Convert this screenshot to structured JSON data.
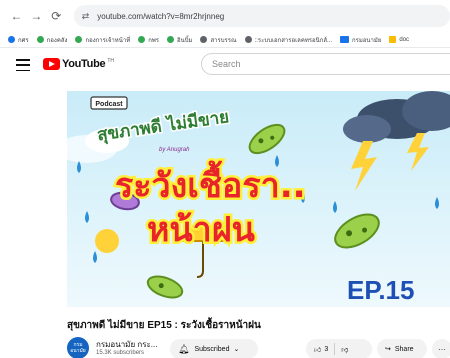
{
  "browser": {
    "url": "youtube.com/watch?v=8mr2hrjnneg",
    "bookmarks": [
      {
        "label": "กศร",
        "icon": "globe-icon"
      },
      {
        "label": "กองคลัง",
        "icon": "globe-icon"
      },
      {
        "label": "กองการเจ้าหน้าที่",
        "icon": "globe-icon"
      },
      {
        "label": "กพร",
        "icon": "globe-icon"
      },
      {
        "label": "อินบิ้ม",
        "icon": "globe-icon"
      },
      {
        "label": "สารบรรณ",
        "icon": "globe-icon"
      },
      {
        "label": "::ระบบเอกสารอเลคทรอนิกส์...",
        "icon": "globe-icon"
      },
      {
        "label": "กรมอนามัย",
        "icon": "folder-icon"
      },
      {
        "label": "doc",
        "icon": "docs-icon"
      }
    ]
  },
  "header": {
    "logo_text": "YouTube",
    "logo_region": "TH",
    "search_placeholder": "Search"
  },
  "thumbnail": {
    "podcast_tag": "Podcast",
    "show_title": "สุขภาพดี ไม่มีขาย",
    "byline": "by Anugrah",
    "headline_1": "ระวังเชื้อรา..",
    "headline_2": "หน้าฝน",
    "episode": "EP.15"
  },
  "video": {
    "title": "สุขภาพดี ไม่มีขาย EP15 : ระวังเชื้อราหน้าฝน",
    "channel_name": "กรมอนามัย กระ...",
    "channel_avatar_text": "กรม อนามัย",
    "subscribers": "15.3K subscribers",
    "subscribed_label": "Subscribed",
    "like_count": "3",
    "share_label": "Share",
    "more_label": "···"
  },
  "colors": {
    "youtube_red": "#ff0000",
    "thumb_sky": "#d9f2fb",
    "headline_red": "#e8232a",
    "headline_outline": "#ffef3a",
    "ep_blue": "#1e4fb5"
  }
}
